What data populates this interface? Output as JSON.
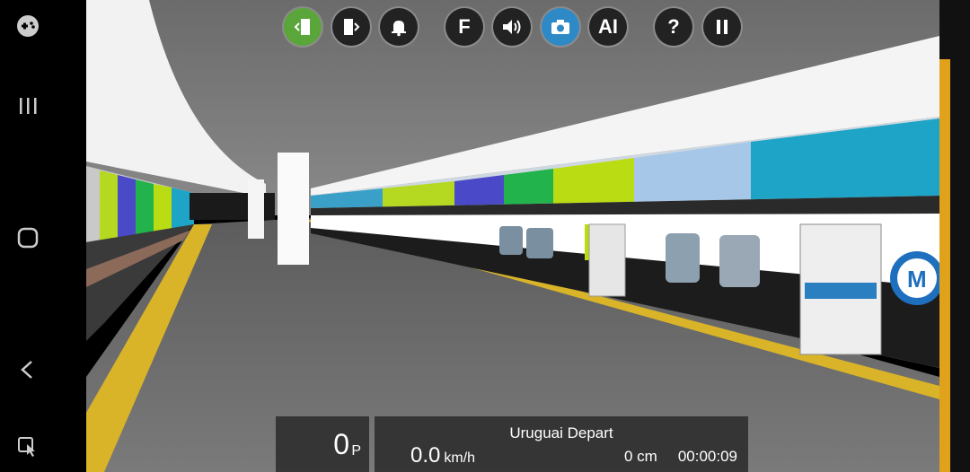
{
  "top_buttons": [
    {
      "name": "door-left-button",
      "icon": "door-left-icon",
      "label": ""
    },
    {
      "name": "door-right-button",
      "icon": "door-right-icon",
      "label": ""
    },
    {
      "name": "bell-button",
      "icon": "bell-icon",
      "label": ""
    },
    {
      "name": "f-button",
      "icon": "",
      "label": "F"
    },
    {
      "name": "sound-button",
      "icon": "speaker-icon",
      "label": ""
    },
    {
      "name": "camera-button",
      "icon": "camera-icon",
      "label": ""
    },
    {
      "name": "ai-button",
      "icon": "",
      "label": "AI"
    },
    {
      "name": "help-button",
      "icon": "",
      "label": "?"
    },
    {
      "name": "pause-button",
      "icon": "pause-icon",
      "label": ""
    }
  ],
  "hud": {
    "power_value": "0",
    "power_unit": "P",
    "station": "Uruguai Depart",
    "speed_value": "0.0",
    "speed_unit": "km/h",
    "distance": "0 cm",
    "timer": "00:00:09"
  },
  "colors": {
    "active_green": "#5aa63a",
    "active_blue": "#2e89c7",
    "hud_bg": "#303030",
    "accent_orange": "#e0a21b"
  }
}
